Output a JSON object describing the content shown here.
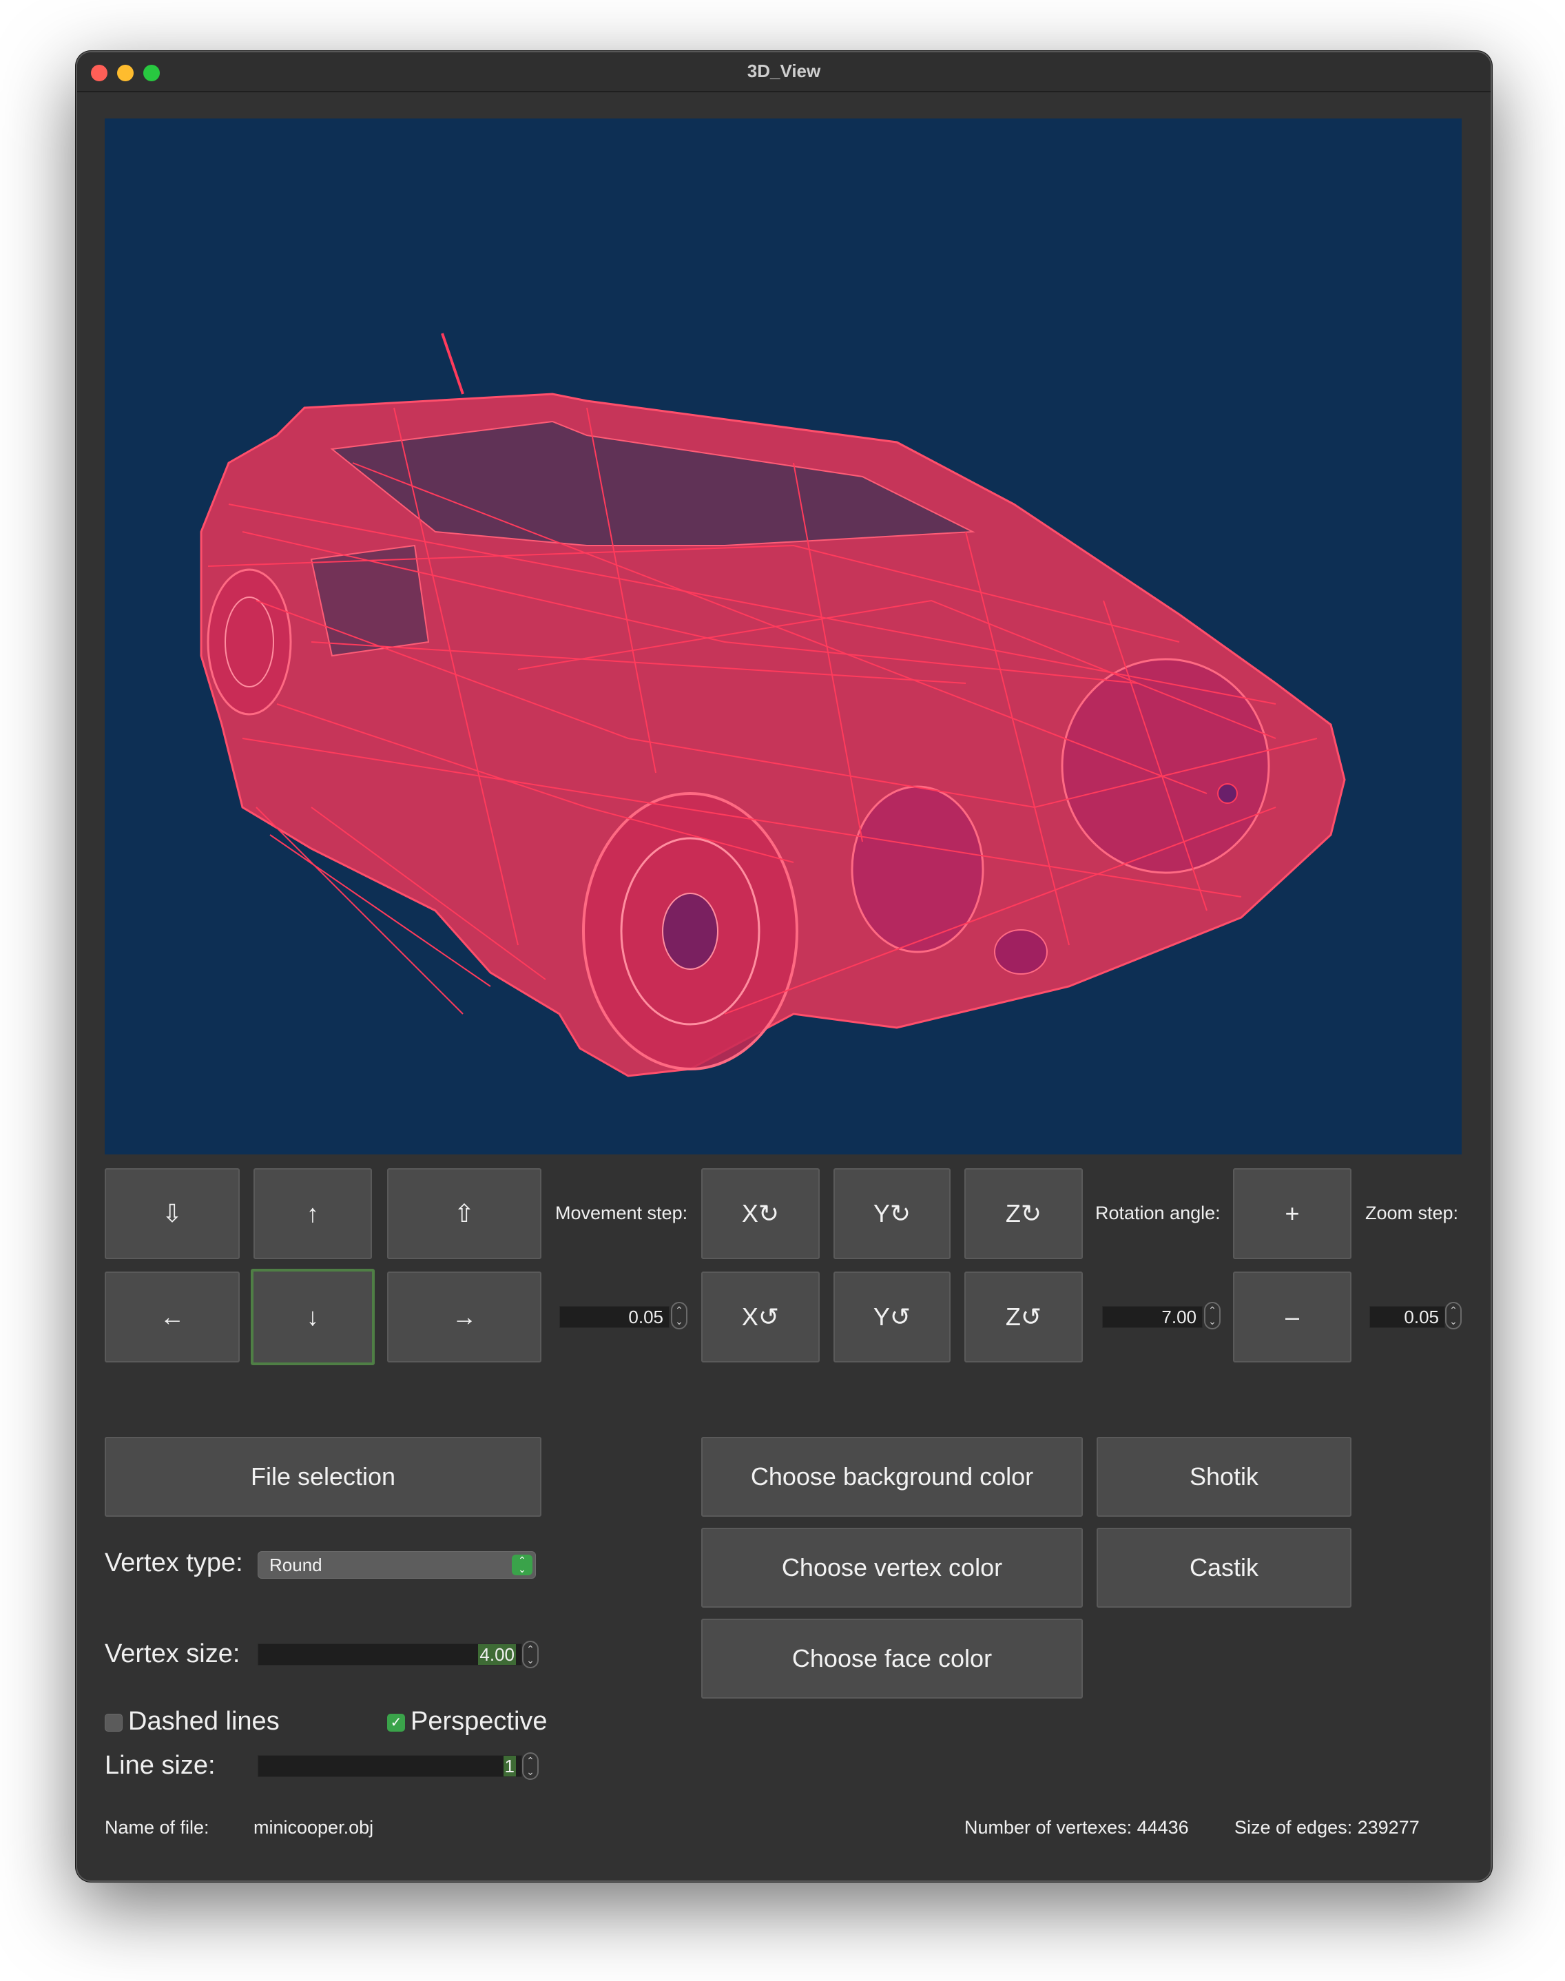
{
  "window": {
    "title": "3D_View"
  },
  "controls": {
    "move_up_icon": "↑",
    "move_down_icon": "↓",
    "move_left_icon": "←",
    "move_right_icon": "→",
    "move_in_icon": "⇩",
    "move_out_icon": "⇧",
    "movement_step_label": "Movement step:",
    "movement_step_value": "0.05",
    "rotate_x_cw": "X↻",
    "rotate_y_cw": "Y↻",
    "rotate_z_cw": "Z↻",
    "rotate_x_ccw": "X↺",
    "rotate_y_ccw": "Y↺",
    "rotate_z_ccw": "Z↺",
    "rotation_angle_label": "Rotation angle:",
    "rotation_angle_value": "7.00",
    "zoom_in": "+",
    "zoom_out": "–",
    "zoom_step_label": "Zoom step:",
    "zoom_step_value": "0.05"
  },
  "settings": {
    "file_selection": "File selection",
    "vertex_type_label": "Vertex type:",
    "vertex_type_value": "Round",
    "vertex_size_label": "Vertex size:",
    "vertex_size_value": "4.00",
    "dashed_lines_label": "Dashed lines",
    "dashed_lines_checked": false,
    "perspective_label": "Perspective",
    "perspective_checked": true,
    "line_size_label": "Line size:",
    "line_size_value": "1",
    "choose_background_color": "Choose background color",
    "choose_vertex_color": "Choose vertex color",
    "choose_face_color": "Choose face color",
    "shotik": "Shotik",
    "castik": "Castik"
  },
  "status": {
    "name_of_file_label": "Name of file:",
    "name_of_file_value": "minicooper.obj",
    "vertex_count": "Number of vertexes: 44436",
    "edge_count": "Size of edges: 239277"
  },
  "colors": {
    "viewport_background": "#0d2f54",
    "model_color": "#ff3b5c",
    "accent_green": "#3aa34a"
  }
}
